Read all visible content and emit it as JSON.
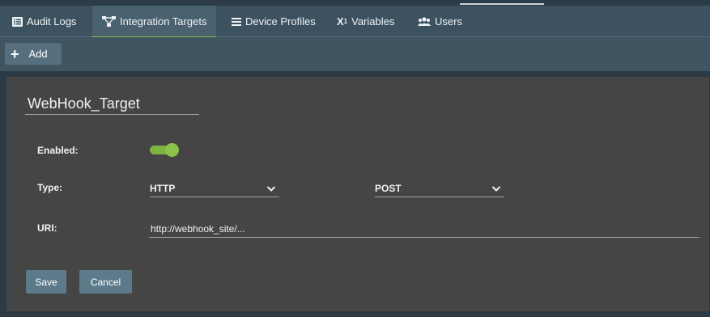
{
  "tabs": [
    {
      "label": "Audit Logs",
      "icon": "list-icon"
    },
    {
      "label": "Integration Targets",
      "icon": "network-icon"
    },
    {
      "label": "Device Profiles",
      "icon": "menu-icon"
    },
    {
      "label": "Variables",
      "icon": "variable-icon"
    },
    {
      "label": "Users",
      "icon": "users-icon"
    }
  ],
  "active_tab": "Integration Targets",
  "toolbar": {
    "add_label": "Add"
  },
  "form": {
    "name": "WebHook_Target",
    "enabled_label": "Enabled:",
    "enabled": true,
    "type_label": "Type:",
    "type_value": "HTTP",
    "method_value": "POST",
    "uri_label": "URI:",
    "uri_value": "http://webhook_site/..."
  },
  "actions": {
    "save_label": "Save",
    "cancel_label": "Cancel"
  },
  "colors": {
    "accent": "#8bc34a",
    "tabbar": "#3d5260",
    "panel": "#454545",
    "button": "#5d7a8a"
  }
}
